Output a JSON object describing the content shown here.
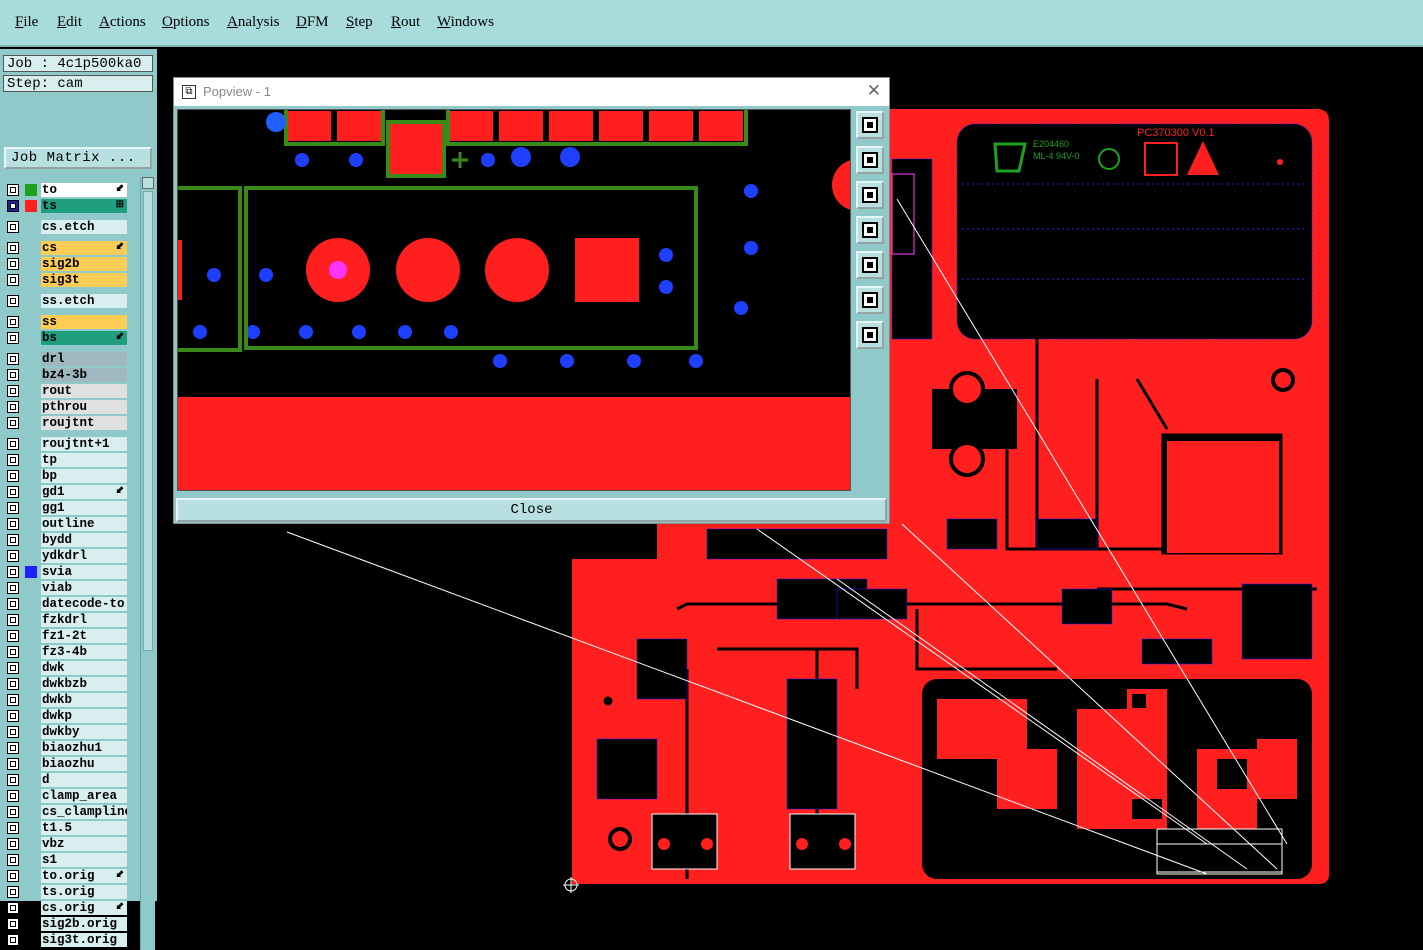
{
  "menu": {
    "items": [
      {
        "label": "File",
        "key": "F"
      },
      {
        "label": "Edit",
        "key": "E"
      },
      {
        "label": "Actions",
        "key": "A"
      },
      {
        "label": "Options",
        "key": "O"
      },
      {
        "label": "Analysis",
        "key": "A"
      },
      {
        "label": "DFM",
        "key": "D"
      },
      {
        "label": "Step",
        "key": "S"
      },
      {
        "label": "Rout",
        "key": "R"
      },
      {
        "label": "Windows",
        "key": "W"
      }
    ]
  },
  "job": {
    "job_label": "Job : 4c1p500ka0",
    "step_label": "Step: cam",
    "matrix_button": "Job Matrix ..."
  },
  "layers": [
    {
      "name": "to",
      "color": "#ffffff",
      "swatch": "#1fa01f",
      "arrow": "⬋"
    },
    {
      "name": "ts",
      "color": "#1f9f7f",
      "swatch": "#ff1f1f",
      "arrow": "⊞",
      "cb_selected": true
    },
    {
      "name": "cs.etch",
      "color": "#d9eeee",
      "gap": true
    },
    {
      "name": "cs",
      "color": "#ffcc55",
      "arrow": "⬋",
      "gap": true
    },
    {
      "name": "sig2b",
      "color": "#ffcc55"
    },
    {
      "name": "sig3t",
      "color": "#ffcc55"
    },
    {
      "name": "ss.etch",
      "color": "#d9eeee",
      "gap": true
    },
    {
      "name": "ss",
      "color": "#ffcc55",
      "gap": true
    },
    {
      "name": "bs",
      "color": "#1f9f7f",
      "arrow": "⬋"
    },
    {
      "name": "drl",
      "color": "#9fb8c0",
      "gap": true
    },
    {
      "name": "bz4-3b",
      "color": "#9fb8c0"
    },
    {
      "name": "rout",
      "color": "#e0e0e0"
    },
    {
      "name": "pthrou",
      "color": "#e0e0e0"
    },
    {
      "name": "roujtnt",
      "color": "#e0e0e0"
    },
    {
      "name": "roujtnt+1",
      "color": "#d9eeee",
      "gap": true
    },
    {
      "name": "tp",
      "color": "#d9eeee"
    },
    {
      "name": "bp",
      "color": "#d9eeee"
    },
    {
      "name": "gd1",
      "color": "#d9eeee",
      "arrow": "⬋"
    },
    {
      "name": "gg1",
      "color": "#d9eeee"
    },
    {
      "name": "outline",
      "color": "#d9eeee"
    },
    {
      "name": "bydd",
      "color": "#d9eeee"
    },
    {
      "name": "ydkdrl",
      "color": "#d9eeee"
    },
    {
      "name": "svia",
      "color": "#d9eeee",
      "swatch": "#1f1fff"
    },
    {
      "name": "viab",
      "color": "#d9eeee"
    },
    {
      "name": "datecode-to",
      "color": "#d9eeee"
    },
    {
      "name": "fzkdrl",
      "color": "#d9eeee"
    },
    {
      "name": "fz1-2t",
      "color": "#d9eeee"
    },
    {
      "name": "fz3-4b",
      "color": "#d9eeee"
    },
    {
      "name": "dwk",
      "color": "#d9eeee"
    },
    {
      "name": "dwkbzb",
      "color": "#d9eeee"
    },
    {
      "name": "dwkb",
      "color": "#d9eeee"
    },
    {
      "name": "dwkp",
      "color": "#d9eeee"
    },
    {
      "name": "dwkby",
      "color": "#d9eeee"
    },
    {
      "name": "biaozhu1",
      "color": "#d9eeee"
    },
    {
      "name": "biaozhu",
      "color": "#d9eeee"
    },
    {
      "name": "d",
      "color": "#d9eeee"
    },
    {
      "name": "clamp_area",
      "color": "#d9eeee"
    },
    {
      "name": "cs_clampline",
      "color": "#d9eeee"
    },
    {
      "name": "t1.5",
      "color": "#d9eeee"
    },
    {
      "name": "vbz",
      "color": "#d9eeee"
    },
    {
      "name": "s1",
      "color": "#d9eeee"
    },
    {
      "name": "to.orig",
      "color": "#d9eeee",
      "arrow": "⬋"
    },
    {
      "name": "ts.orig",
      "color": "#d9eeee"
    },
    {
      "name": "cs.orig",
      "color": "#d9eeee",
      "arrow": "⬋"
    },
    {
      "name": "sig2b.orig",
      "color": "#d9eeee"
    },
    {
      "name": "sig3t.orig",
      "color": "#d9eeee"
    }
  ],
  "popview": {
    "title": "Popview - 1",
    "close_label": "Close",
    "close_x": "✕",
    "tools": [
      "zoom-fit-icon",
      "pan-up-icon",
      "pan-down-icon",
      "pan-left-icon",
      "pan-right-icon",
      "zoom-in-icon",
      "zoom-out-icon"
    ]
  },
  "board": {
    "silk_part": "PC370300 V0.1",
    "silk_ul": "E204460",
    "silk_rating": "ML-4 94V-0",
    "colors": {
      "copper": "#ff1f1f",
      "silk": "#1fa01f",
      "via": "#1f1fff",
      "background": "#000000",
      "panel": "#8fc9c9"
    }
  }
}
